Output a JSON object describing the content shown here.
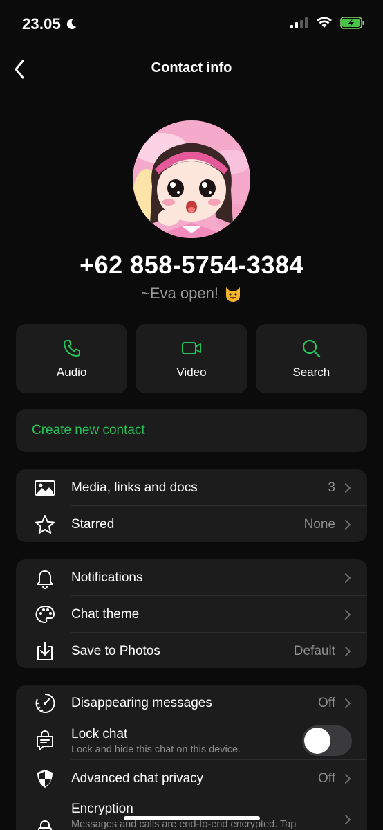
{
  "status": {
    "time": "23.05"
  },
  "nav": {
    "title": "Contact info"
  },
  "profile": {
    "phone": "+62 858-5754-3384",
    "about": "~Eva open!"
  },
  "actions": [
    {
      "label": "Audio",
      "icon": "phone-icon"
    },
    {
      "label": "Video",
      "icon": "video-icon"
    },
    {
      "label": "Search",
      "icon": "search-icon"
    }
  ],
  "create_contact": {
    "label": "Create new contact"
  },
  "section1": [
    {
      "label": "Media, links and docs",
      "value": "3",
      "icon": "image-icon"
    },
    {
      "label": "Starred",
      "value": "None",
      "icon": "star-icon"
    }
  ],
  "section2": [
    {
      "label": "Notifications",
      "value": "",
      "icon": "bell-icon"
    },
    {
      "label": "Chat theme",
      "value": "",
      "icon": "palette-icon"
    },
    {
      "label": "Save to Photos",
      "value": "Default",
      "icon": "save-icon"
    }
  ],
  "section3": [
    {
      "label": "Disappearing messages",
      "value": "Off",
      "icon": "timer-icon"
    },
    {
      "label": "Lock chat",
      "sub": "Lock and hide this chat on this device.",
      "icon": "lock-chat-icon",
      "toggle": false
    },
    {
      "label": "Advanced chat privacy",
      "value": "Off",
      "icon": "shield-icon"
    },
    {
      "label": "Encryption",
      "sub": "Messages and calls are end-to-end encrypted. Tap",
      "icon": "lock-icon"
    }
  ],
  "colors": {
    "accent": "#25c35a",
    "card": "#1c1c1c",
    "background": "#0b0b0b",
    "secondary_text": "#8e8e8e"
  }
}
